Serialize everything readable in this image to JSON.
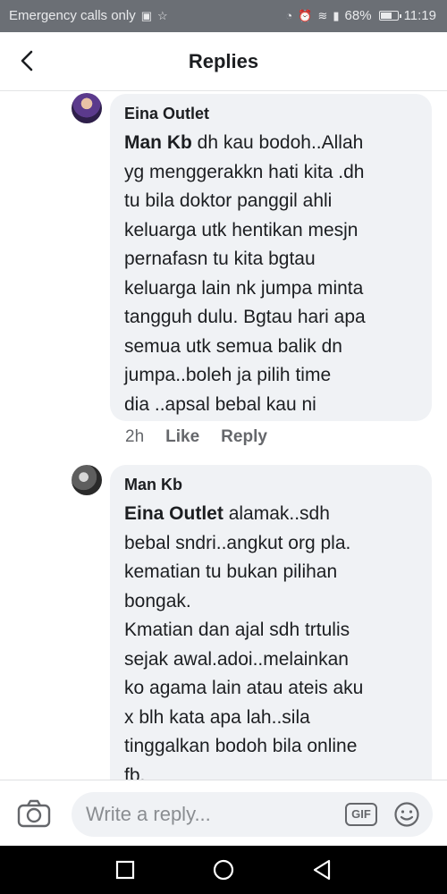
{
  "status_bar": {
    "carrier": "Emergency calls only",
    "battery_percent": "68%",
    "battery_level": 0.68,
    "time": "11:19"
  },
  "header": {
    "title": "Replies",
    "back_icon": "chevron-left-icon"
  },
  "replies": [
    {
      "author": "Eina Outlet",
      "mention": "Man Kb",
      "text": " dh kau bodoh..Allah\nyg menggerakkn hati kita .dh\ntu bila doktor panggil ahli\nkeluarga utk hentikan mesjn\npernafasn tu kita bgtau\nkeluarga lain nk jumpa minta\ntangguh dulu. Bgtau hari apa\nsemua utk semua balik dn\njumpa..boleh ja pilih time\ndia ..apsal bebal kau ni",
      "time": "2h",
      "like_label": "Like",
      "reply_label": "Reply"
    },
    {
      "author": "Man Kb",
      "mention": "Eina Outlet",
      "text": " alamak..sdh\nbebal sndri..angkut org pla.\nkematian tu bukan pilihan\nbongak.\nKmatian dan ajal sdh trtulis\nsejak awal.adoi..melainkan\nko agama lain atau ateis aku\nx blh kata apa lah..sila\ntinggalkan bodoh bila online\nfb."
    }
  ],
  "composer": {
    "placeholder": "Write a reply...",
    "gif_label": "GIF",
    "camera_icon": "camera-icon",
    "emoji_icon": "smiley-icon"
  },
  "colors": {
    "status_bar": "#6b6f75",
    "bubble": "#f0f2f5",
    "meta_text": "#65676b"
  }
}
